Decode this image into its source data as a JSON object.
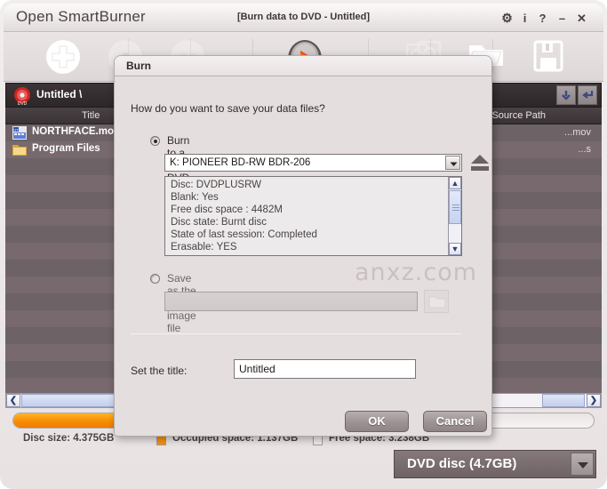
{
  "window": {
    "app_title": "Open SmartBurner",
    "document_title": "[Burn data to DVD - Untitled]",
    "controls": {
      "settings": "⚙",
      "info": "i",
      "help": "?",
      "minimize": "–",
      "close": "✕"
    }
  },
  "toolbar": {
    "items": [
      {
        "name": "add-files",
        "icon": "plus-circle-icon"
      },
      {
        "name": "blank-disc",
        "icon": "disc-icon"
      },
      {
        "name": "iso-image",
        "icon": "iso-icon"
      },
      {
        "name": "burn",
        "icon": "burn-record-icon"
      },
      {
        "name": "copy-disc",
        "icon": "copy-disc-icon"
      },
      {
        "name": "open-folder",
        "icon": "folder-icon"
      },
      {
        "name": "save-project",
        "icon": "floppy-save-icon"
      }
    ]
  },
  "project_bar": {
    "label": "Untitled \\",
    "disc_icon": "dvd-disc-icon",
    "down_button": "move-down-icon",
    "enter_button": "enter-icon"
  },
  "file_list": {
    "columns": [
      {
        "key": "title",
        "label": "Title"
      },
      {
        "key": "source_path",
        "label": "Source Path"
      }
    ],
    "rows": [
      {
        "title": "NORTHFACE.mov",
        "icon": "quicktime-movie-icon",
        "source_path": "...mov"
      },
      {
        "title": "Program Files",
        "icon": "folder-icon",
        "source_path": "...s"
      }
    ]
  },
  "status": {
    "disc_size": "Disc size: 4.375GB",
    "occupied_space": "Occupied space: 1.137GB",
    "free_space": "Free space: 3.238GB",
    "occupied_color": "#f6920c",
    "free_color": "#efebeb",
    "fill_percent": 26
  },
  "disc_type": {
    "selected": "DVD disc (4.7GB)",
    "arrow": "chevron-down-icon"
  },
  "dialog": {
    "title": "Burn",
    "question": "How do you want to save your data files?",
    "option_burn": {
      "label": "Burn to a blank DVD disc",
      "selected": true
    },
    "drive": {
      "value": "K: PIONEER  BD-RW   BDR-206",
      "arrow": "chevron-down-icon",
      "eject_icon": "eject-icon"
    },
    "disc_info": [
      "Disc: DVDPLUSRW",
      "Blank: Yes",
      "Free disc space : 4482M",
      "Disc state: Burnt disc",
      "State of last session: Completed",
      "Erasable: YES"
    ],
    "option_iso": {
      "label": "Save as the ISO image file",
      "selected": false
    },
    "iso_path": {
      "value": "",
      "browse_icon": "folder-browse-icon"
    },
    "title_field": {
      "label": "Set the title:",
      "value": "Untitled"
    },
    "buttons": {
      "ok": "OK",
      "cancel": "Cancel"
    }
  },
  "watermark": {
    "text": "anxz.com"
  }
}
